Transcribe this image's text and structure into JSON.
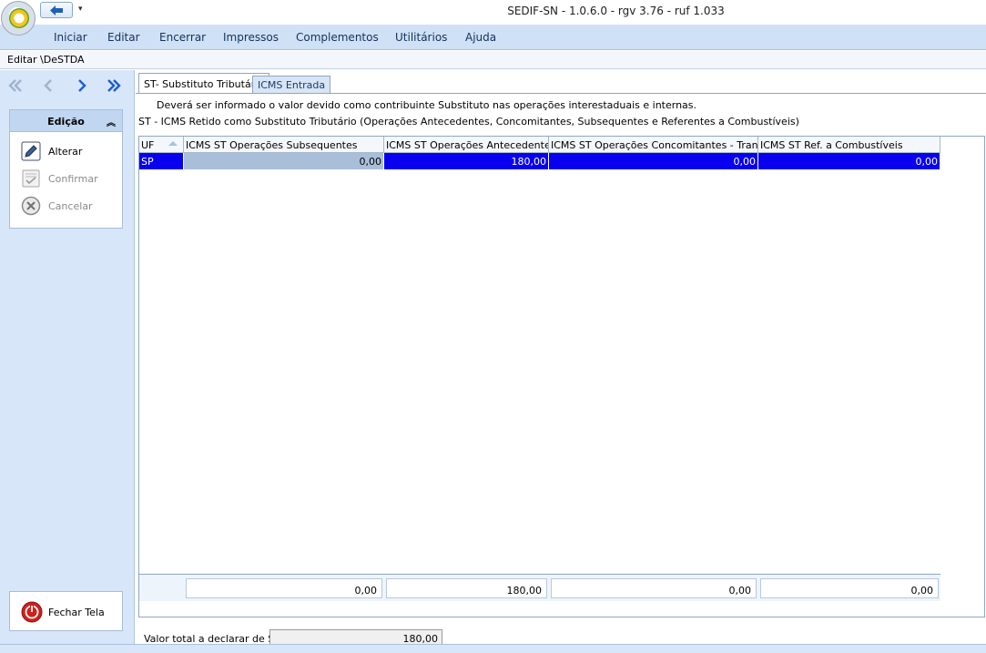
{
  "window": {
    "title": "SEDIF-SN - 1.0.6.0 - rgv 3.76 - ruf 1.033"
  },
  "menu": {
    "items": [
      "Iniciar",
      "Editar",
      "Encerrar",
      "Impressos",
      "Complementos",
      "Utilitários",
      "Ajuda"
    ]
  },
  "breadcrumb": "Editar \\DeSTDA",
  "sidebar": {
    "edicao_title": "Edição",
    "actions": [
      {
        "label": "Alterar",
        "enabled": true
      },
      {
        "label": "Confirmar",
        "enabled": false
      },
      {
        "label": "Cancelar",
        "enabled": false
      }
    ],
    "close_label": "Fechar Tela"
  },
  "tabs": [
    {
      "label": "ST- Substituto Tributário",
      "active": true
    },
    {
      "label": "ICMS Entrada",
      "active": false
    }
  ],
  "info": {
    "line1": "Deverá ser informado o valor devido como contribuinte Substituto nas operações interestaduais e internas.",
    "line2": "ST - ICMS Retido como Substituto Tributário (Operações Antecedentes, Concomitantes, Subsequentes e Referentes a Combustíveis)"
  },
  "grid": {
    "columns": [
      "UF",
      "ICMS ST Operações Subsequentes",
      "ICMS ST Operações Antecedentes",
      "ICMS ST Operações Concomitantes - Transp.",
      "ICMS ST Ref. a Combustíveis"
    ],
    "rows": [
      [
        "SP",
        "0,00",
        "180,00",
        "0,00",
        "0,00"
      ]
    ],
    "totals": [
      "0,00",
      "180,00",
      "0,00",
      "0,00"
    ]
  },
  "valor_total": {
    "label": "Valor total a declarar de ST",
    "value": "180,00"
  },
  "colors": {
    "menu_bg": "#cfe1f6",
    "selection": "#0a00f0",
    "sidebar_bg": "#d7e6f8"
  }
}
